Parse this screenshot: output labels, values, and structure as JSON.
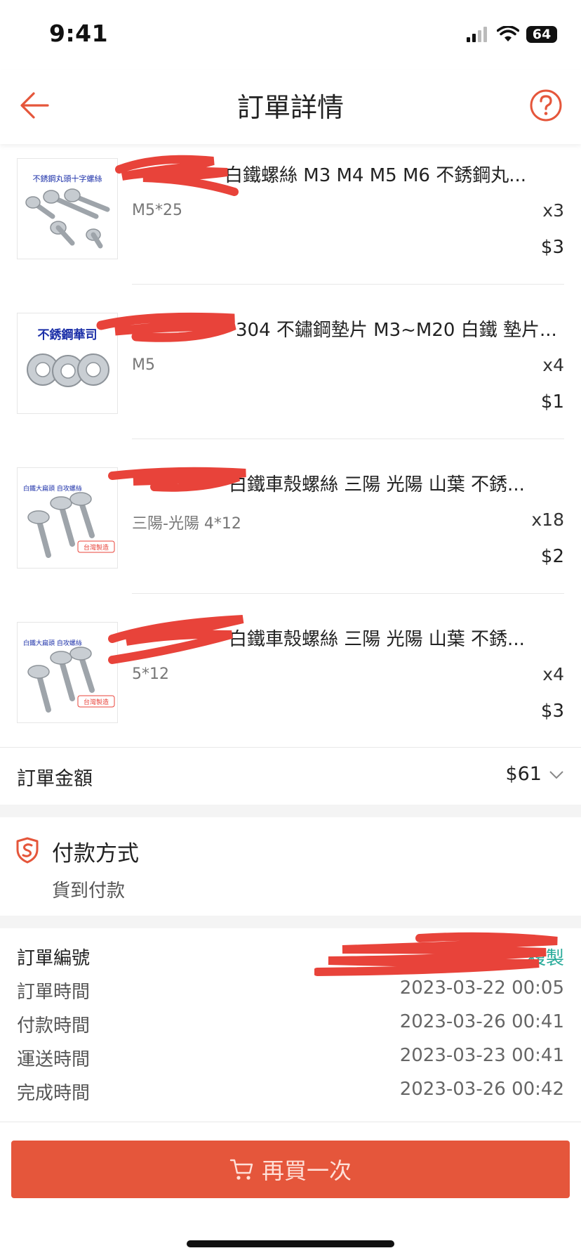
{
  "status_bar": {
    "time": "9:41",
    "battery": "64"
  },
  "header": {
    "title": "訂單詳情"
  },
  "products": [
    {
      "name": "白鐵螺絲 M3 M4 M5 M6 不銹鋼丸...",
      "thumb_text": "不銹鋼丸頭十字螺絲",
      "variant": "M5*25",
      "quantity": "x3",
      "price": "$3"
    },
    {
      "name": "304 不鏽鋼墊片 M3~M20 白鐵 墊片...",
      "thumb_text": "不銹鋼華司",
      "variant": "M5",
      "quantity": "x4",
      "price": "$1"
    },
    {
      "name": "白鐵車殼螺絲 三陽 光陽 山葉 不銹...",
      "thumb_text": "白鐵大扁頭 自攻螺絲",
      "thumb_badge": "台灣製造",
      "variant": "三陽-光陽 4*12",
      "quantity": "x18",
      "price": "$2"
    },
    {
      "name": "白鐵車殼螺絲 三陽 光陽 山葉 不銹...",
      "thumb_text": "白鐵大扁頭 自攻螺絲",
      "thumb_badge": "台灣製造",
      "variant": "5*12",
      "quantity": "x4",
      "price": "$3"
    }
  ],
  "order_total": {
    "label": "訂單金額",
    "value": "$61"
  },
  "payment": {
    "title": "付款方式",
    "method": "貨到付款"
  },
  "order_info": {
    "number_label": "訂單編號",
    "copy_label": "複製",
    "rows": [
      {
        "label": "訂單時間",
        "value": "2023-03-22 00:05"
      },
      {
        "label": "付款時間",
        "value": "2023-03-26 00:41"
      },
      {
        "label": "運送時間",
        "value": "2023-03-23 00:41"
      },
      {
        "label": "完成時間",
        "value": "2023-03-26 00:42"
      }
    ]
  },
  "footer": {
    "rebuy_label": "再買一次"
  },
  "colors": {
    "accent": "#e5563b",
    "copy_link": "#26aa99",
    "redaction": "#e8433a"
  }
}
